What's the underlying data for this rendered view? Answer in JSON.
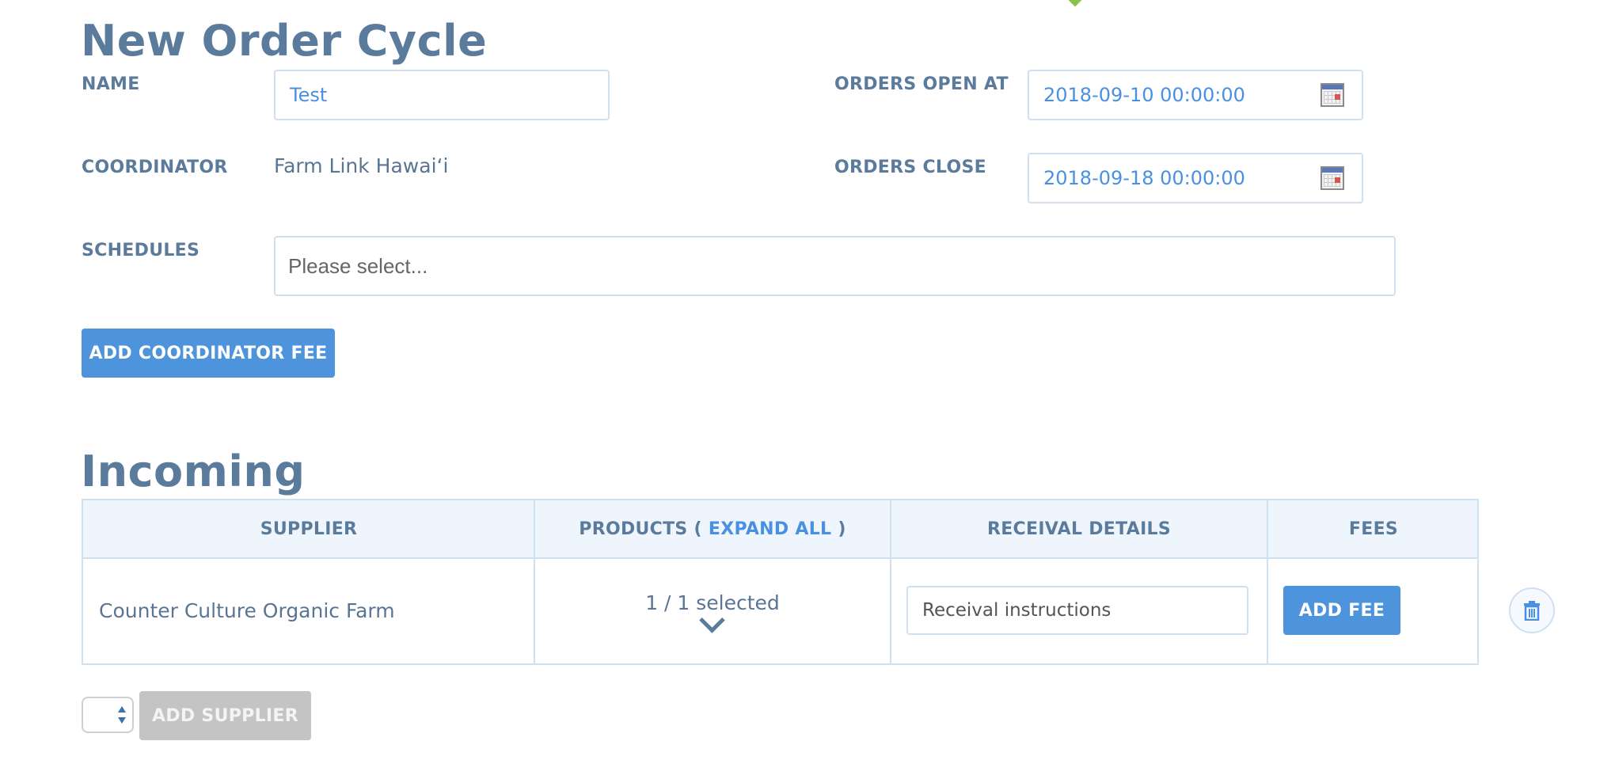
{
  "order_cycle": {
    "title": "New Order Cycle",
    "name_label": "NAME",
    "name_value": "Test",
    "coordinator_label": "COORDINATOR",
    "coordinator_value": "Farm Link Hawai‘i",
    "schedules_label": "SCHEDULES",
    "schedules_placeholder": "Please select...",
    "orders_open_label": "ORDERS OPEN AT",
    "orders_open_value": "2018-09-10 00:00:00",
    "orders_close_label": "ORDERS CLOSE",
    "orders_close_value": "2018-09-18 00:00:00",
    "add_coordinator_fee_label": "ADD COORDINATOR FEE",
    "calendar_icon": "calendar-icon"
  },
  "incoming": {
    "title": "Incoming",
    "columns": {
      "supplier": "SUPPLIER",
      "products_prefix": "PRODUCTS ( ",
      "expand_all": "EXPAND ALL",
      "products_suffix": " )",
      "receival_details": "RECEIVAL DETAILS",
      "fees": "FEES"
    },
    "rows": [
      {
        "supplier": "Counter Culture Organic Farm",
        "products_selected": "1 / 1 selected",
        "receival_placeholder": "Receival instructions",
        "add_fee_label": "ADD FEE",
        "expand_icon": "chevron-down-icon",
        "remove_icon": "trash-icon"
      }
    ],
    "supplier_select_value": "",
    "add_supplier_label": "ADD SUPPLIER"
  },
  "colors": {
    "heading": "#5b7b9c",
    "accent": "#4a90e2",
    "button_primary": "#4e94dc",
    "button_disabled": "#c4c4c4",
    "border": "#cfe0f1",
    "table_header_bg": "#eef5fc"
  }
}
